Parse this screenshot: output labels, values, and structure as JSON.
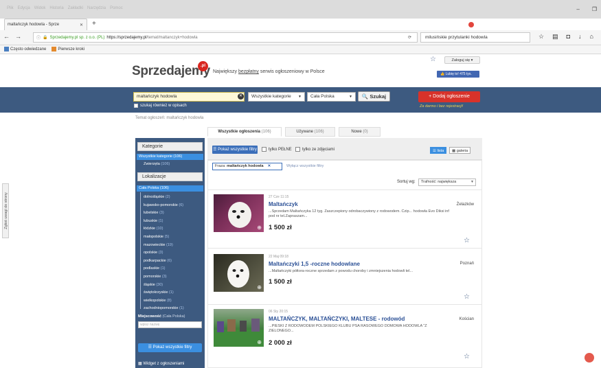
{
  "browser": {
    "menu": [
      "Plik",
      "Edycja",
      "Widok",
      "Historia",
      "Zakładki",
      "Narzędzia",
      "Pomoc"
    ],
    "tab_title": "maltańczyk hodowla - Sprze",
    "url_site": "Sprzedajemy.pl sp. z o.o. (PL)",
    "url_base": "https://sprzedajemy.pl",
    "url_path": "/temat/maltanczyk+hodowla",
    "search_value": "milusińskie przytulanki hodowla",
    "bookmarks": [
      "Często odwiedzane",
      "Pierwsze kroki"
    ]
  },
  "header": {
    "logo": "Sprzedajemy",
    "logo_pl": ".pl",
    "tagline_pre": "Największy",
    "tagline_u": "bezpłatny",
    "tagline_post": "serwis ogłoszeniowy w Polsce",
    "login": "Zaloguj się",
    "fb_like": "Lubię to! 475 tys."
  },
  "search": {
    "query": "maltańczyk hodowla",
    "category": "Wszystkie kategorie",
    "region": "Cała Polska",
    "button": "Szukaj",
    "checkbox_label": "szukaj również w opisach",
    "add_button": "+ Dodaj ogłoszenie",
    "add_sub": "Za darmo i bez rejestracji!"
  },
  "breadcrumb": "Temat ogłoszeń: maltańczyk hodowla",
  "tabs": [
    {
      "label": "Wszystkie ogłoszenia",
      "count": "(106)"
    },
    {
      "label": "Używane",
      "count": "(106)"
    },
    {
      "label": "Nowe",
      "count": "(0)"
    }
  ],
  "sidebar": {
    "kategorie": "Kategorie",
    "all_categories": "Wszystkie kategorie (106)",
    "zwierzeta": "Zwierzęta",
    "zwierzeta_count": "(106)",
    "lokalizacje": "Lokalizacje",
    "cala_polska": "Cała Polska (106)",
    "regions": [
      {
        "name": "dolnośląskie",
        "count": "(2)"
      },
      {
        "name": "kujawsko-pomorskie",
        "count": "(6)"
      },
      {
        "name": "lubelskie",
        "count": "(3)"
      },
      {
        "name": "lubuskie",
        "count": "(1)"
      },
      {
        "name": "łódzkie",
        "count": "(10)"
      },
      {
        "name": "małopolskie",
        "count": "(5)"
      },
      {
        "name": "mazowieckie",
        "count": "(19)"
      },
      {
        "name": "opolskie",
        "count": "(3)"
      },
      {
        "name": "podkarpackie",
        "count": "(6)"
      },
      {
        "name": "podlaskie",
        "count": "(1)"
      },
      {
        "name": "pomorskie",
        "count": "(3)"
      },
      {
        "name": "śląskie",
        "count": "(30)"
      },
      {
        "name": "świętokrzyskie",
        "count": "(1)"
      },
      {
        "name": "wielkopolskie",
        "count": "(8)"
      },
      {
        "name": "zachodniopomorskie",
        "count": "(1)"
      }
    ],
    "miejscowosc": "Miejscowość",
    "miejscowosc_scope": "(Cała Polska)",
    "miejscowosc_placeholder": "wpisz nazwę",
    "show_filters": "Pokaż wszystkie filtry",
    "widget": "Widget z ogłoszeniami"
  },
  "filters": {
    "show_all": "Pokaż wszystkie filtry",
    "only_full": "tylko PEŁNE",
    "only_photos": "tylko ze zdjęciami",
    "view_list": "lista",
    "view_gallery": "galeria",
    "phrase_label": "Fraza:",
    "phrase_value": "maltańczyk hodowla",
    "clear": "Wyłącz wszystkie filtry",
    "sort_label": "Sortuj wg:",
    "sort_value": "Trafność: największa"
  },
  "listings": [
    {
      "date": "27 Cze 11:15",
      "title": "Maltańczyk",
      "city": "Żelazków",
      "desc": "...Sprzedam Maltańczyka 12 tyg. Zaszczepiony odrobaczywiony z rodowodem. Czip... hodowla Evo Diksi inf pod nr tel.Zapraszam...",
      "price": "1 500 zł"
    },
    {
      "date": "22 Maj 09:18",
      "title": "Maltańczyki 1,5 -roczne hodowlane",
      "city": "Poznań",
      "desc": "...Maltańczyki półtora-roczne sprzedam z powodu choroby i zmniejszenia hodowli tel...",
      "price": "1 500 zł"
    },
    {
      "date": "06 Sty 20:15",
      "title": "MALTAŃCZYK, MALTAŃCZYKI, MALTESE - rodowód",
      "city": "Kościan",
      "desc": "...PIESKI Z RODOWODEM POLSKIEGO KLUBU PSA RASOWEGO DOMOWA HODOWLA \"Z ZIELONEGO...",
      "price": "2 000 zł"
    }
  ],
  "report_side": "Zgłoś uwagi do strony"
}
